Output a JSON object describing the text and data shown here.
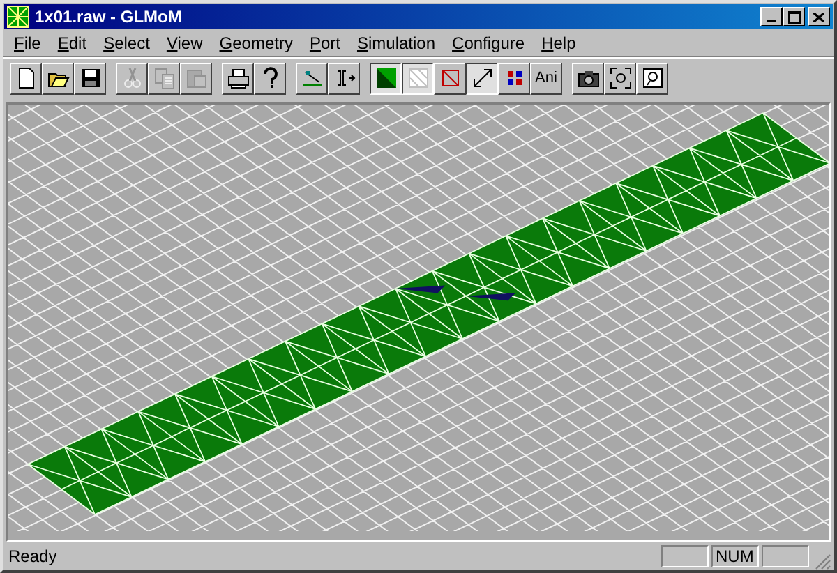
{
  "window": {
    "title": "1x01.raw - GLMoM"
  },
  "menu": [
    "File",
    "Edit",
    "Select",
    "View",
    "Geometry",
    "Port",
    "Simulation",
    "Configure",
    "Help"
  ],
  "toolbar": [
    {
      "kind": "new",
      "disabled": false,
      "pressed": false
    },
    {
      "kind": "open",
      "disabled": false,
      "pressed": false
    },
    {
      "kind": "save",
      "disabled": false,
      "pressed": false
    },
    {
      "kind": "separator"
    },
    {
      "kind": "cut",
      "disabled": true,
      "pressed": false
    },
    {
      "kind": "copy",
      "disabled": true,
      "pressed": false
    },
    {
      "kind": "paste",
      "disabled": true,
      "pressed": false
    },
    {
      "kind": "separator"
    },
    {
      "kind": "print",
      "disabled": false,
      "pressed": false
    },
    {
      "kind": "help",
      "disabled": false,
      "pressed": false
    },
    {
      "kind": "separator"
    },
    {
      "kind": "probe",
      "disabled": false,
      "pressed": false
    },
    {
      "kind": "port",
      "disabled": false,
      "pressed": false
    },
    {
      "kind": "separator"
    },
    {
      "kind": "solid",
      "disabled": false,
      "pressed": true
    },
    {
      "kind": "wire",
      "disabled": false,
      "pressed": true
    },
    {
      "kind": "outline",
      "disabled": false,
      "pressed": false
    },
    {
      "kind": "expand",
      "disabled": false,
      "pressed": true
    },
    {
      "kind": "colors",
      "disabled": false,
      "pressed": false
    },
    {
      "kind": "text",
      "label": "Ani",
      "disabled": false,
      "pressed": false
    },
    {
      "kind": "separator"
    },
    {
      "kind": "camera",
      "disabled": false,
      "pressed": false
    },
    {
      "kind": "fit",
      "disabled": false,
      "pressed": false
    },
    {
      "kind": "zoom",
      "disabled": false,
      "pressed": false
    }
  ],
  "status_bar": {
    "message": "Ready",
    "panels": [
      {
        "kind": "empty"
      },
      {
        "kind": "text",
        "text": "NUM"
      },
      {
        "kind": "empty"
      }
    ]
  }
}
